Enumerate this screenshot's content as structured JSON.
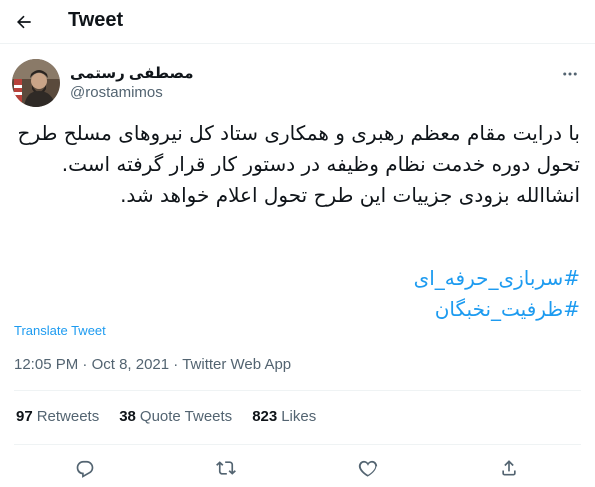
{
  "header": {
    "title": "Tweet",
    "back_icon": "arrow-left-icon"
  },
  "author": {
    "display_name": "مصطفی رستمی",
    "handle": "@rostamimos"
  },
  "tweet": {
    "text": "با درایت مقام معظم رهبری و همکاری ستاد کل نیروهای مسلح طرح تحول دوره خدمت نظام وظیفه در دستور کار قرار گرفته است. انشاالله بزودی جزییات این طرح تحول اعلام خواهد شد.",
    "hashtags": [
      "#سربازی_حرفه_ای",
      "#ظرفیت_نخبگان"
    ],
    "translate_label": "Translate Tweet",
    "time": "12:05 PM",
    "date": "Oct 8, 2021",
    "source": "Twitter Web App",
    "separator": "·"
  },
  "stats": {
    "retweets_count": "97",
    "retweets_label": "Retweets",
    "quotes_count": "38",
    "quotes_label": "Quote Tweets",
    "likes_count": "823",
    "likes_label": "Likes"
  },
  "colors": {
    "accent": "#1d9bf0",
    "text": "#0f1419",
    "secondary": "#536471",
    "divider": "#eff3f4"
  },
  "icons": [
    "arrow-left-icon",
    "more-icon",
    "reply-icon",
    "retweet-icon",
    "like-icon",
    "share-icon"
  ]
}
